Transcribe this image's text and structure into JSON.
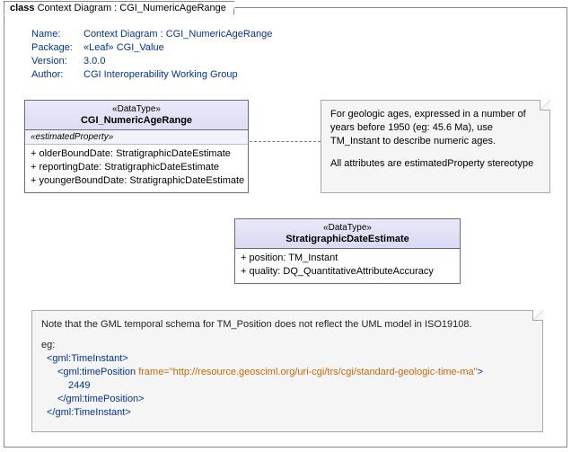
{
  "frame": {
    "prefix": "class",
    "title": "Context Diagram : CGI_NumericAgeRange"
  },
  "meta": {
    "name_label": "Name:",
    "name_value": "Context Diagram : CGI_NumericAgeRange",
    "package_label": "Package:",
    "package_value": "«Leaf» CGI_Value",
    "version_label": "Version:",
    "version_value": "3.0.0",
    "author_label": "Author:",
    "author_value": "CGI Interoperability Working Group"
  },
  "class1": {
    "stereotype": "«DataType»",
    "name": "CGI_NumericAgeRange",
    "section_label": "«estimatedProperty»",
    "attrs": [
      "+   olderBoundDate: StratigraphicDateEstimate",
      "+   reportingDate: StratigraphicDateEstimate",
      "+   youngerBoundDate: StratigraphicDateEstimate"
    ]
  },
  "class2": {
    "stereotype": "«DataType»",
    "name": "StratigraphicDateEstimate",
    "attrs": [
      "+   position: TM_Instant",
      "+   quality: DQ_QuantitativeAttributeAccuracy"
    ]
  },
  "note1": {
    "line1": "For geologic ages, expressed in a number of years before 1950 (eg: 45.6 Ma), use TM_Instant to describe numeric ages.",
    "line2": "All attributes are estimatedProperty stereotype"
  },
  "note2": {
    "intro": "Note that the GML temporal schema for TM_Position does not reflect the UML model in ISO19108.",
    "eg_label": "eg:",
    "l1": "<gml:TimeInstant>",
    "l2a": "<gml:timePosition ",
    "l2attr": "frame=",
    "l2val": "\"http://resource.geosciml.org/uri-cgi/trs/cgi/standard-geologic-time-ma\"",
    "l2b": ">",
    "l3": "2449",
    "l4": "</gml:timePosition>",
    "l5": "</gml:TimeInstant>"
  }
}
